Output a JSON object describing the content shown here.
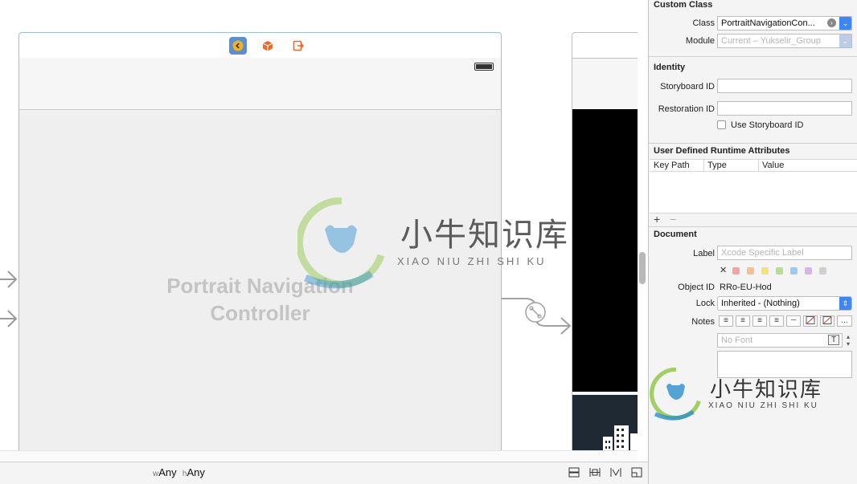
{
  "canvas": {
    "scene_title_line1": "Portrait Navigation",
    "scene_title_line2": "Controller",
    "size_class": {
      "w_prefix": "w",
      "w_value": "Any",
      "h_prefix": "h",
      "h_value": "Any"
    }
  },
  "inspector": {
    "custom_class": {
      "title": "Custom Class",
      "class_label": "Class",
      "class_value": "PortraitNavigationCon...",
      "module_label": "Module",
      "module_placeholder": "Current – Yukselir_Group"
    },
    "identity": {
      "title": "Identity",
      "storyboard_id_label": "Storyboard ID",
      "restoration_id_label": "Restoration ID",
      "use_storyboard_id_label": "Use Storyboard ID"
    },
    "runtime_attributes": {
      "title": "User Defined Runtime Attributes",
      "columns": [
        "Key Path",
        "Type",
        "Value"
      ],
      "add": "+",
      "remove": "−"
    },
    "document": {
      "title": "Document",
      "label_label": "Label",
      "label_placeholder": "Xcode Specific Label",
      "clear": "✕",
      "object_id_label": "Object ID",
      "object_id_value": "RRo-EU-Hod",
      "lock_label": "Lock",
      "lock_value": "Inherited - (Nothing)",
      "notes_label": "Notes",
      "font_placeholder": "No Font",
      "more": "..."
    }
  },
  "watermark": {
    "cn": "小牛知识库",
    "en": "XIAO NIU ZHI SHI KU"
  },
  "colors": {
    "accent": "#3d86f5",
    "scene_border": "#9cbde0",
    "back_icon": "#f5b41e",
    "cube_icon": "#ea6a2a",
    "exit_icon": "#ea6a2a",
    "logo_green": "#8cc63f",
    "logo_blue": "#2a8fd0"
  },
  "label_swatches": [
    "#f4a3a3",
    "#f7c08c",
    "#f4e27a",
    "#b5e08e",
    "#9ccbf2",
    "#d6b3ec",
    "#cfcfcf"
  ]
}
